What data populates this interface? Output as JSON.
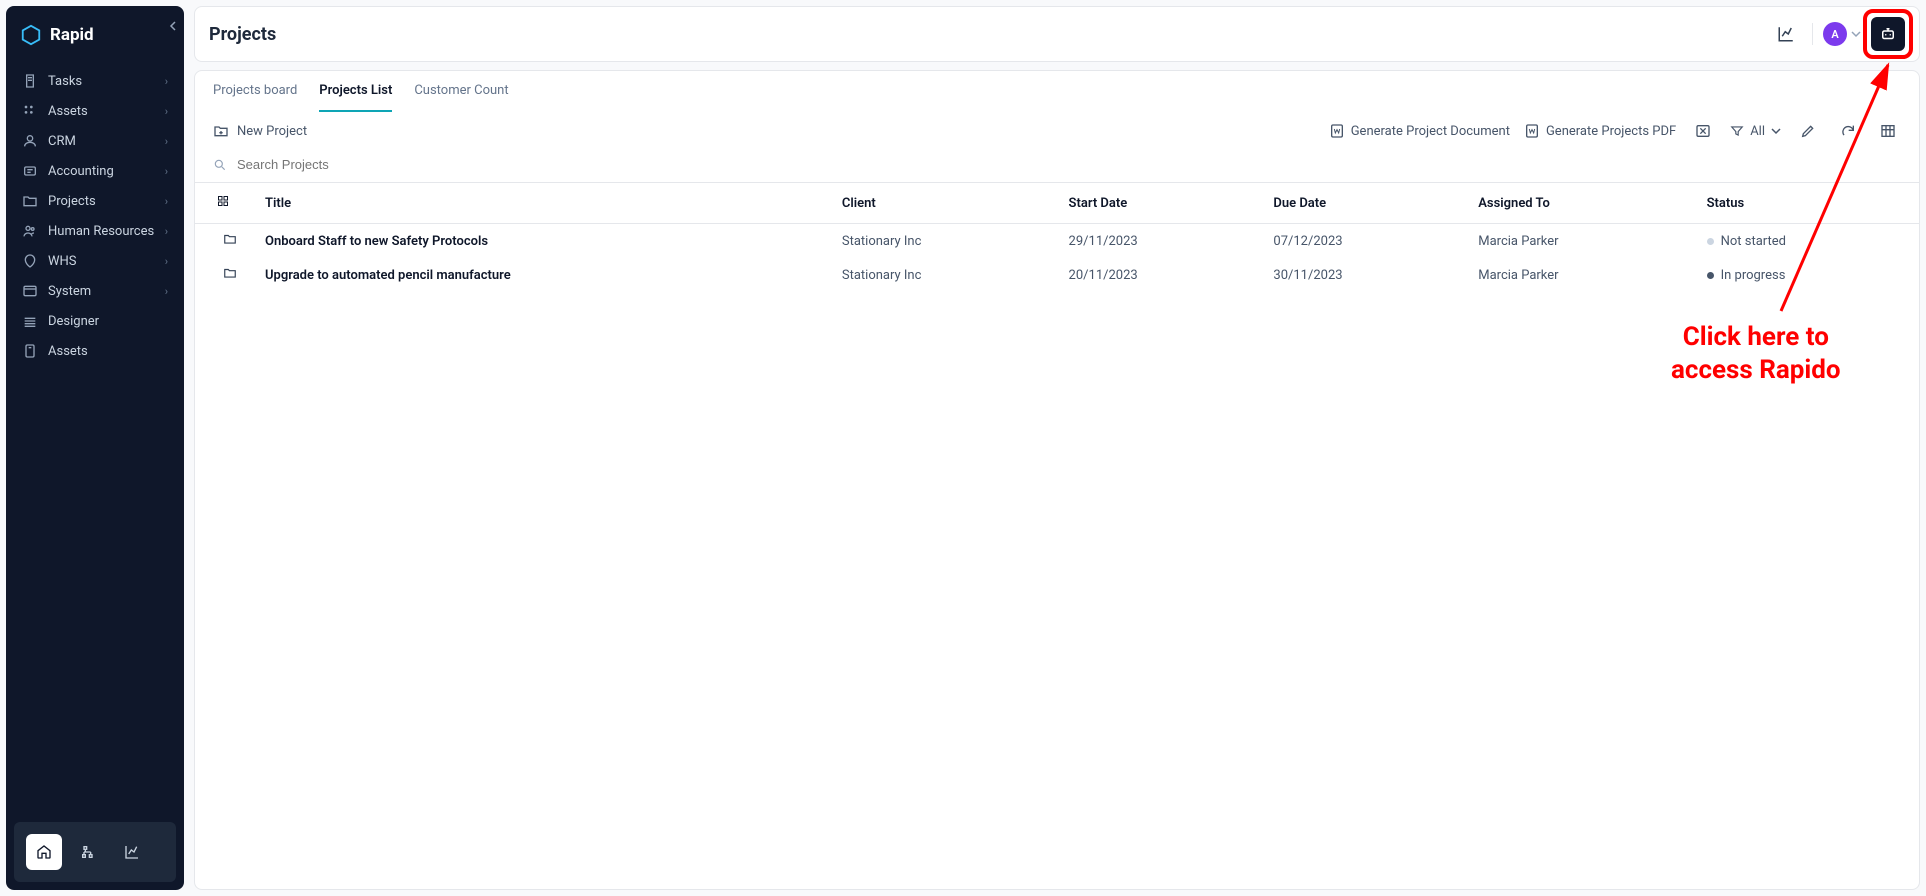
{
  "brand": "Rapid",
  "sidebar": {
    "items": [
      {
        "label": "Tasks",
        "has_children": true
      },
      {
        "label": "Assets",
        "has_children": true
      },
      {
        "label": "CRM",
        "has_children": true
      },
      {
        "label": "Accounting",
        "has_children": true
      },
      {
        "label": "Projects",
        "has_children": true
      },
      {
        "label": "Human Resources",
        "has_children": true
      },
      {
        "label": "WHS",
        "has_children": true
      },
      {
        "label": "System",
        "has_children": true
      },
      {
        "label": "Designer",
        "has_children": false
      },
      {
        "label": "Assets",
        "has_children": false
      }
    ]
  },
  "header": {
    "title": "Projects",
    "avatar_letter": "A"
  },
  "tabs": [
    {
      "label": "Projects board",
      "active": false
    },
    {
      "label": "Projects List",
      "active": true
    },
    {
      "label": "Customer Count",
      "active": false
    }
  ],
  "actions": {
    "new_project": "New Project",
    "gen_doc": "Generate Project Document",
    "gen_pdf": "Generate Projects PDF",
    "filter_label": "All"
  },
  "search": {
    "placeholder": "Search Projects"
  },
  "table": {
    "columns": [
      "Title",
      "Client",
      "Start Date",
      "Due Date",
      "Assigned To",
      "Status"
    ],
    "rows": [
      {
        "title": "Onboard Staff to new Safety Protocols",
        "client": "Stationary Inc",
        "start": "29/11/2023",
        "due": "07/12/2023",
        "assigned": "Marcia Parker",
        "status": "Not started",
        "status_dot": "gray"
      },
      {
        "title": "Upgrade to automated pencil manufacture",
        "client": "Stationary Inc",
        "start": "20/11/2023",
        "due": "30/11/2023",
        "assigned": "Marcia Parker",
        "status": "In progress",
        "status_dot": "dark"
      }
    ]
  },
  "annotation": {
    "text": "Click here to access Rapido"
  }
}
